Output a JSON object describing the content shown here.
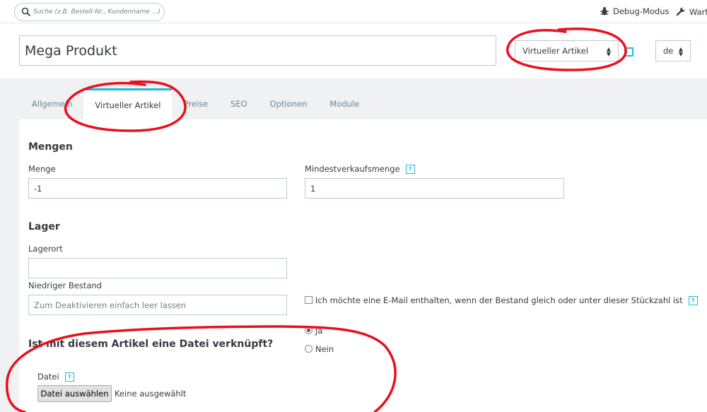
{
  "topbar": {
    "search_placeholder": "Suche (z.B. Bestell-Nr., Kundenname ...)",
    "debug_label": "Debug-Modus",
    "maintenance_label": "Wart"
  },
  "header": {
    "product_name": "Mega Produkt",
    "product_type": "Virtueller Artikel",
    "language": "de"
  },
  "tabs": [
    "Allgemein",
    "Virtueller Artikel",
    "Preise",
    "SEO",
    "Optionen",
    "Module"
  ],
  "quantities": {
    "heading": "Mengen",
    "quantity_label": "Menge",
    "quantity_value": "-1",
    "min_label": "Mindestverkaufsmenge",
    "min_value": "1",
    "help_glyph": "?"
  },
  "stock": {
    "heading": "Lager",
    "location_label": "Lagerort",
    "location_value": "",
    "low_label": "Niedriger Bestand",
    "low_placeholder": "Zum Deaktivieren einfach leer lassen",
    "email_label": "Ich möchte eine E-Mail enthalten, wenn der Bestand gleich oder unter dieser Stückzahl ist"
  },
  "file": {
    "question": "Ist mit diesem Artikel eine Datei verknüpft?",
    "yes": "Ja",
    "no": "Nein",
    "selected": "Ja",
    "file_label": "Datei",
    "choose_button": "Datei auswählen",
    "no_file": "Keine ausgewählt"
  },
  "colors": {
    "accent": "#25b9d7",
    "annotation": "#e8101d",
    "band": "#eff1f2"
  }
}
